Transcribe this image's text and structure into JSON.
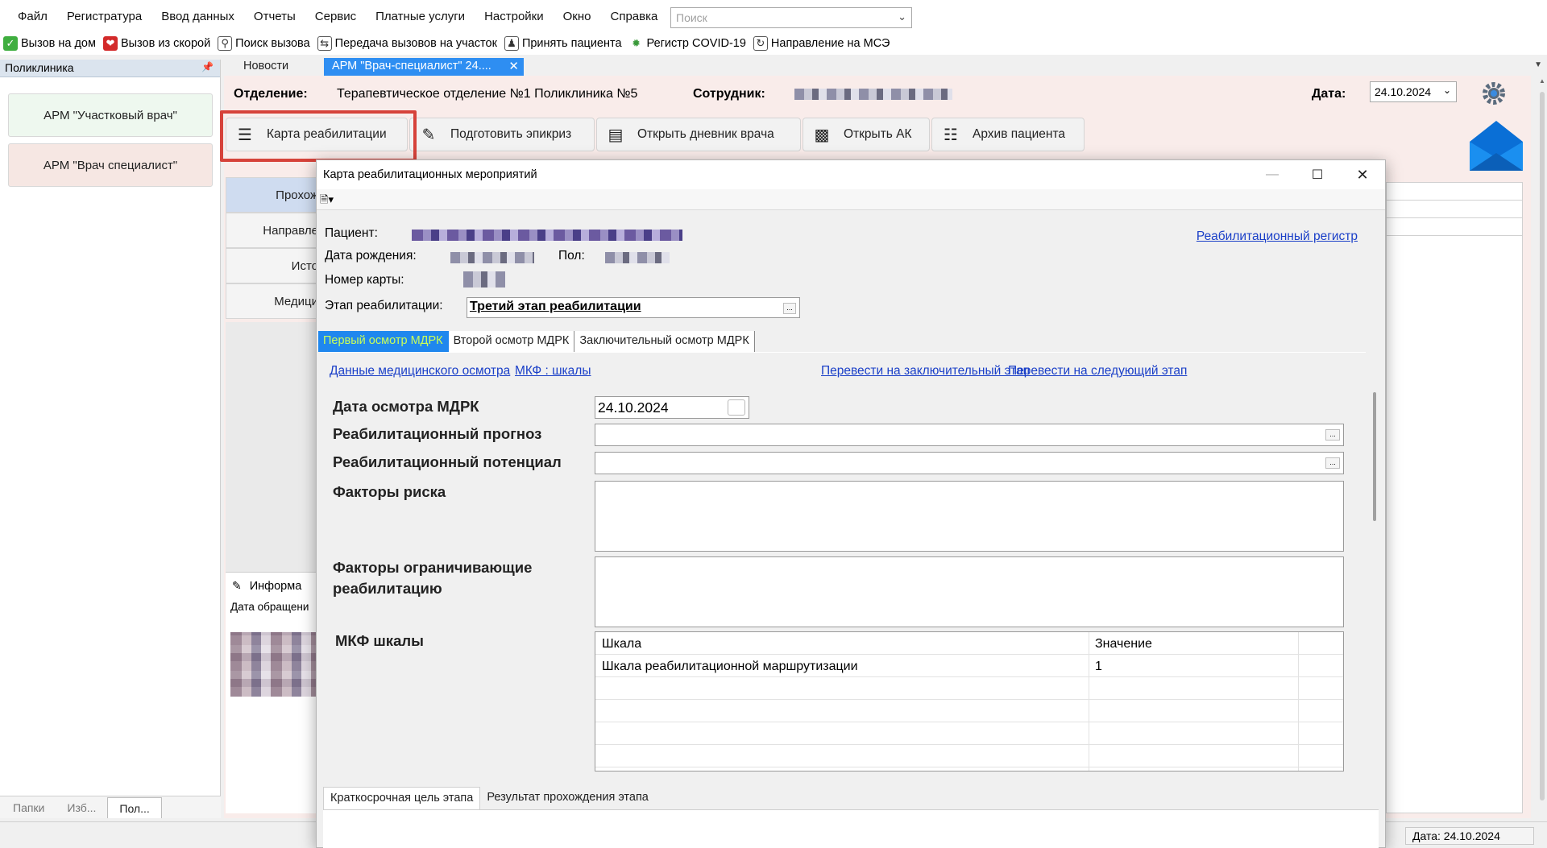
{
  "menu": [
    "Файл",
    "Регистратура",
    "Ввод данных",
    "Отчеты",
    "Сервис",
    "Платные услуги",
    "Настройки",
    "Окно",
    "Справка"
  ],
  "search": {
    "placeholder": "Поиск"
  },
  "toolbar": [
    "Вызов на дом",
    "Вызов из скорой",
    "Поиск вызова",
    "Передача вызовов на участок",
    "Принять пациента",
    "Регистр COVID-19",
    "Направление на МСЭ"
  ],
  "left_panel": {
    "title": "Поликлиника",
    "buttons": [
      "АРМ \"Участковый врач\"",
      "АРМ \"Врач специалист\""
    ],
    "tabs": [
      "Папки",
      "Изб...",
      "Пол..."
    ]
  },
  "doc_tabs": [
    "Новости",
    "АРМ \"Врач-специалист\" 24...."
  ],
  "header": {
    "dept_label": "Отделение:",
    "dept_value": "Терапевтическое отделение №1 Поликлиника №5",
    "employee_label": "Сотрудник:",
    "date_label": "Дата:",
    "date_value": "24.10.2024"
  },
  "actions": [
    "Карта реабилитации",
    "Подготовить эпикриз",
    "Открыть дневник врача",
    "Открыть АК",
    "Архив пациента"
  ],
  "side_nav": [
    "Прохож",
    "Направле",
    "Исто",
    "Медици"
  ],
  "info": {
    "title": "Информа",
    "sub": "Дата обращени"
  },
  "status": {
    "date": "Дата: 24.10.2024"
  },
  "modal": {
    "title": "Карта реабилитационных мероприятий",
    "patient_label": "Пациент:",
    "dob_label": "Дата рождения:",
    "sex_label": "Пол:",
    "card_label": "Номер карты:",
    "stage_label": "Этап реабилитации:",
    "stage_value": "Третий этап реабилитации",
    "registry_link": "Реабилитационный регистр",
    "tabs": [
      "Первый осмотр МДРК",
      "Второй осмотр МДРК",
      "Заключительный осмотр МДРК"
    ],
    "links": [
      "Данные медицинского осмотра",
      "МКФ : шкалы",
      "Перевести на заключительный этап",
      "Перевести на следующий этап"
    ],
    "fields": {
      "exam_date_label": "Дата осмотра МДРК",
      "exam_date_value": "24.10.2024",
      "prognosis_label": "Реабилитационный прогноз",
      "potential_label": "Реабилитационный потенциал",
      "risk_label": "Факторы риска",
      "limiting_label_1": "Факторы ограничивающие",
      "limiting_label_2": "реабилитацию",
      "mkf_label": "МКФ шкалы"
    },
    "grid": {
      "headers": [
        "Шкала",
        "Значение"
      ],
      "rows": [
        [
          "Шкала реабилитационной маршрутизации",
          "1"
        ]
      ]
    },
    "bottom_tabs": [
      "Краткосрочная цель этапа",
      "Результат прохождения этапа"
    ]
  }
}
